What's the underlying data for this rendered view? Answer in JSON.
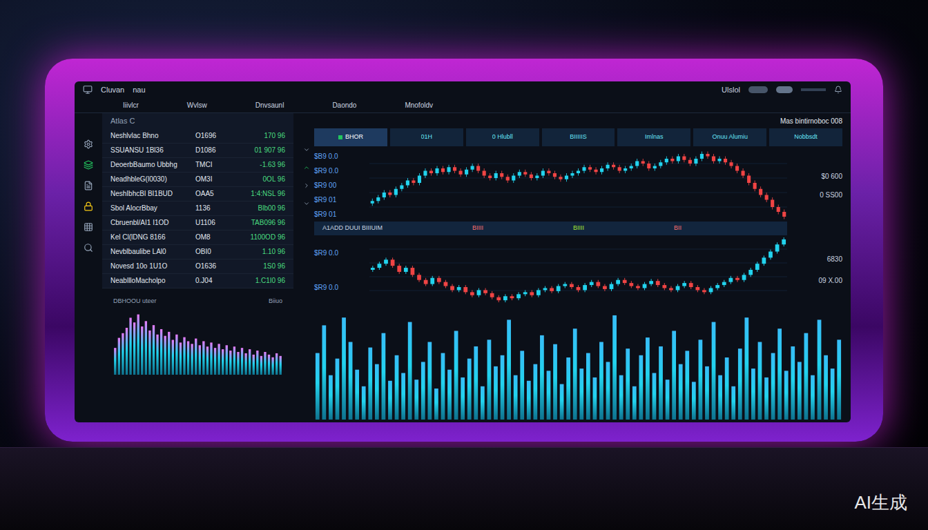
{
  "window": {
    "title": "Cluvan",
    "subtitle": "nau",
    "user": "Ulslol"
  },
  "nav": [
    "Iiivlcr",
    "Wvlsw",
    "Dnvsaunl",
    "Daondo",
    "Mnofoldv"
  ],
  "watchlist": {
    "title": "Atlas C",
    "rows": [
      {
        "name": "Neshlvlac Bhno",
        "code": "O1696",
        "change": "170 96"
      },
      {
        "name": "SSUANSU 1Bl36",
        "code": "D1086",
        "change": "01 907 96"
      },
      {
        "name": "DeoerbBaumo Ubbhg",
        "code": "TMCI",
        "change": "-1.63 96"
      },
      {
        "name": "NeadhbleG(l0030)",
        "code": "OM3I",
        "change": "0OL 96"
      },
      {
        "name": "NeshIbhcBl BI1BUD",
        "code": "OAA5",
        "change": "1:4:NSL 96"
      },
      {
        "name": "Sbol AlocrBbay",
        "code": "1136",
        "change": "Blb00 96"
      },
      {
        "name": "Cbruenbl/AI1 I1OD",
        "code": "U1106",
        "change": "TAB096 96"
      },
      {
        "name": "Kel Cl(lDNG 8166",
        "code": "OM8",
        "change": "1100OD 96"
      },
      {
        "name": "Nevblbaulibe LAl0",
        "code": "OBI0",
        "change": "1.10 96"
      },
      {
        "name": "Novesd 10o 1U1O",
        "code": "O1636",
        "change": "1S0 96"
      },
      {
        "name": "NeabllloMacholpo",
        "code": "0.J04",
        "change": "1.C1I0 96"
      }
    ]
  },
  "small_chart": {
    "title": "DBHOOU uteer",
    "label": "Biiuo",
    "values": [
      40,
      55,
      62,
      70,
      85,
      78,
      90,
      72,
      80,
      66,
      74,
      60,
      68,
      58,
      64,
      52,
      60,
      48,
      56,
      50,
      46,
      54,
      44,
      50,
      42,
      48,
      40,
      46,
      38,
      44,
      36,
      42,
      34,
      40,
      32,
      38,
      30,
      36,
      28,
      34,
      30,
      26,
      32,
      28
    ]
  },
  "main_chart": {
    "title": "Mas bintirnoboc 008",
    "tabs": [
      {
        "label": "BHOR",
        "selected": true
      },
      {
        "label": "01H",
        "selected": false
      },
      {
        "label": "0 Hlubll",
        "selected": false
      },
      {
        "label": "BIIIIIS",
        "selected": false
      },
      {
        "label": "Imlnas",
        "selected": false
      },
      {
        "label": "Onuu Alumiu",
        "selected": false
      },
      {
        "label": "Nobbsdt",
        "selected": false
      }
    ],
    "upper_labels": [
      "$B9 0.0",
      "$R9 0.0",
      "$R9 00",
      "$R9 01",
      "$R9 01"
    ],
    "upper_right": [
      "$0 600",
      "0 SS00"
    ],
    "band": [
      "A1ADD DUUI BIIIUIM",
      "BIIII",
      "BIIII",
      "BII"
    ],
    "lower_labels": [
      "$R9 0.0",
      "$R9 0.0"
    ],
    "lower_right": [
      "6830",
      "09 X.00"
    ],
    "upper": [
      45,
      48,
      52,
      50,
      55,
      58,
      62,
      60,
      66,
      70,
      68,
      72,
      69,
      73,
      70,
      67,
      71,
      74,
      70,
      66,
      64,
      68,
      65,
      62,
      66,
      69,
      67,
      64,
      66,
      70,
      68,
      65,
      63,
      66,
      68,
      70,
      73,
      71,
      69,
      72,
      75,
      73,
      70,
      72,
      74,
      78,
      76,
      72,
      74,
      77,
      80,
      78,
      82,
      79,
      76,
      80,
      84,
      82,
      78,
      80,
      77,
      74,
      70,
      66,
      60,
      55,
      50,
      46,
      40,
      36,
      32
    ],
    "lower": [
      62,
      66,
      70,
      64,
      58,
      62,
      55,
      50,
      46,
      52,
      48,
      44,
      40,
      43,
      38,
      35,
      40,
      37,
      33,
      30,
      34,
      32,
      36,
      38,
      35,
      40,
      42,
      39,
      44,
      46,
      43,
      40,
      45,
      48,
      44,
      41,
      46,
      50,
      47,
      44,
      42,
      46,
      49,
      45,
      42,
      40,
      44,
      47,
      43,
      40,
      38,
      42,
      45,
      48,
      52,
      50,
      55,
      60,
      66,
      72,
      78,
      85,
      90
    ],
    "volume": [
      60,
      85,
      40,
      55,
      92,
      70,
      45,
      30,
      65,
      50,
      78,
      35,
      58,
      42,
      88,
      36,
      52,
      70,
      28,
      60,
      45,
      80,
      38,
      55,
      66,
      30,
      72,
      48,
      58,
      90,
      40,
      62,
      35,
      50,
      76,
      44,
      68,
      32,
      56,
      82,
      46,
      60,
      38,
      70,
      52,
      94,
      40,
      64,
      30,
      58,
      74,
      42,
      66,
      36,
      80,
      50,
      62,
      34,
      72,
      48,
      88,
      40,
      56,
      30,
      64,
      92,
      46,
      70,
      38,
      60,
      82,
      44,
      66,
      52,
      78,
      40,
      90,
      58,
      46,
      72
    ]
  },
  "watermark": "AI生成"
}
